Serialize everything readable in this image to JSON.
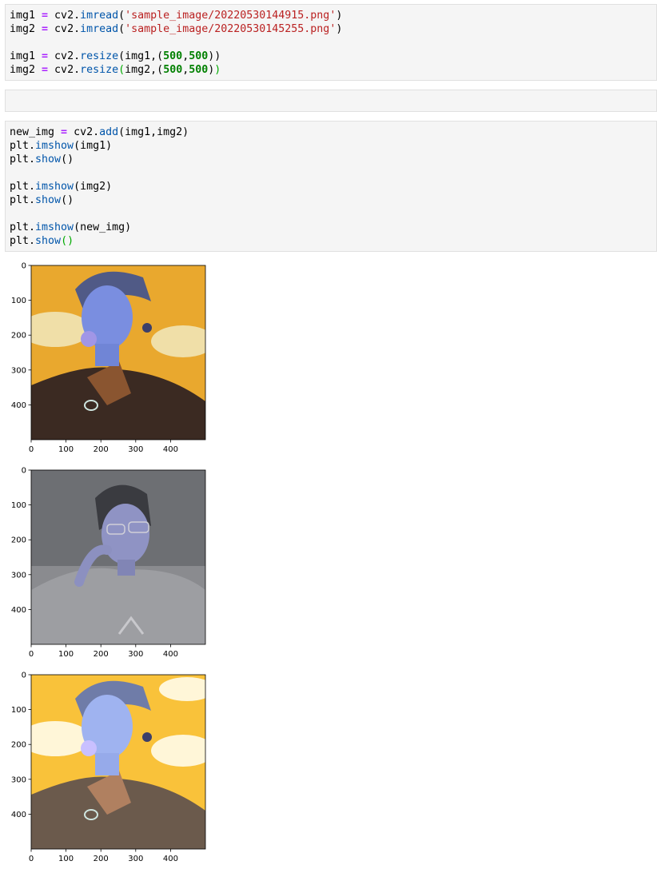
{
  "cells": [
    {
      "lines": [
        [
          {
            "t": "img1 "
          },
          {
            "t": "=",
            "c": "op"
          },
          {
            "t": " cv2."
          },
          {
            "t": "imread",
            "c": "attr"
          },
          {
            "t": "("
          },
          {
            "t": "'sample_image/20220530144915.png'",
            "c": "str"
          },
          {
            "t": ")"
          }
        ],
        [
          {
            "t": "img2 "
          },
          {
            "t": "=",
            "c": "op"
          },
          {
            "t": " cv2."
          },
          {
            "t": "imread",
            "c": "attr"
          },
          {
            "t": "("
          },
          {
            "t": "'sample_image/20220530145255.png'",
            "c": "str"
          },
          {
            "t": ")"
          }
        ],
        [],
        [
          {
            "t": "img1 "
          },
          {
            "t": "=",
            "c": "op"
          },
          {
            "t": " cv2."
          },
          {
            "t": "resize",
            "c": "attr"
          },
          {
            "t": "(img1,("
          },
          {
            "t": "500",
            "c": "num"
          },
          {
            "t": ","
          },
          {
            "t": "500",
            "c": "num"
          },
          {
            "t": "))"
          }
        ],
        [
          {
            "t": "img2 "
          },
          {
            "t": "=",
            "c": "op"
          },
          {
            "t": " cv2."
          },
          {
            "t": "resize",
            "c": "attr"
          },
          {
            "t": "(",
            "c": "green"
          },
          {
            "t": "img2,("
          },
          {
            "t": "500",
            "c": "num"
          },
          {
            "t": ","
          },
          {
            "t": "500",
            "c": "num"
          },
          {
            "t": ")"
          },
          {
            "t": ")",
            "c": "green"
          }
        ]
      ]
    },
    {
      "lines": []
    },
    {
      "lines": [
        [
          {
            "t": "new_img "
          },
          {
            "t": "=",
            "c": "op"
          },
          {
            "t": " cv2."
          },
          {
            "t": "add",
            "c": "attr"
          },
          {
            "t": "(img1,img2)"
          }
        ],
        [
          {
            "t": "plt."
          },
          {
            "t": "imshow",
            "c": "attr"
          },
          {
            "t": "(img1)"
          }
        ],
        [
          {
            "t": "plt."
          },
          {
            "t": "show",
            "c": "attr"
          },
          {
            "t": "()"
          }
        ],
        [],
        [
          {
            "t": "plt."
          },
          {
            "t": "imshow",
            "c": "attr"
          },
          {
            "t": "(img2)"
          }
        ],
        [
          {
            "t": "plt."
          },
          {
            "t": "show",
            "c": "attr"
          },
          {
            "t": "()"
          }
        ],
        [],
        [
          {
            "t": "plt."
          },
          {
            "t": "imshow",
            "c": "attr"
          },
          {
            "t": "(new_img)"
          }
        ],
        [
          {
            "t": "plt."
          },
          {
            "t": "show",
            "c": "attr"
          },
          {
            "t": "()",
            "c": "green"
          }
        ]
      ]
    }
  ],
  "outputs": [
    {
      "variant": "img1"
    },
    {
      "variant": "img2"
    },
    {
      "variant": "new_img"
    }
  ],
  "axes": {
    "x_ticks": [
      "0",
      "100",
      "200",
      "300",
      "400"
    ],
    "y_ticks": [
      "0",
      "100",
      "200",
      "300",
      "400"
    ]
  }
}
